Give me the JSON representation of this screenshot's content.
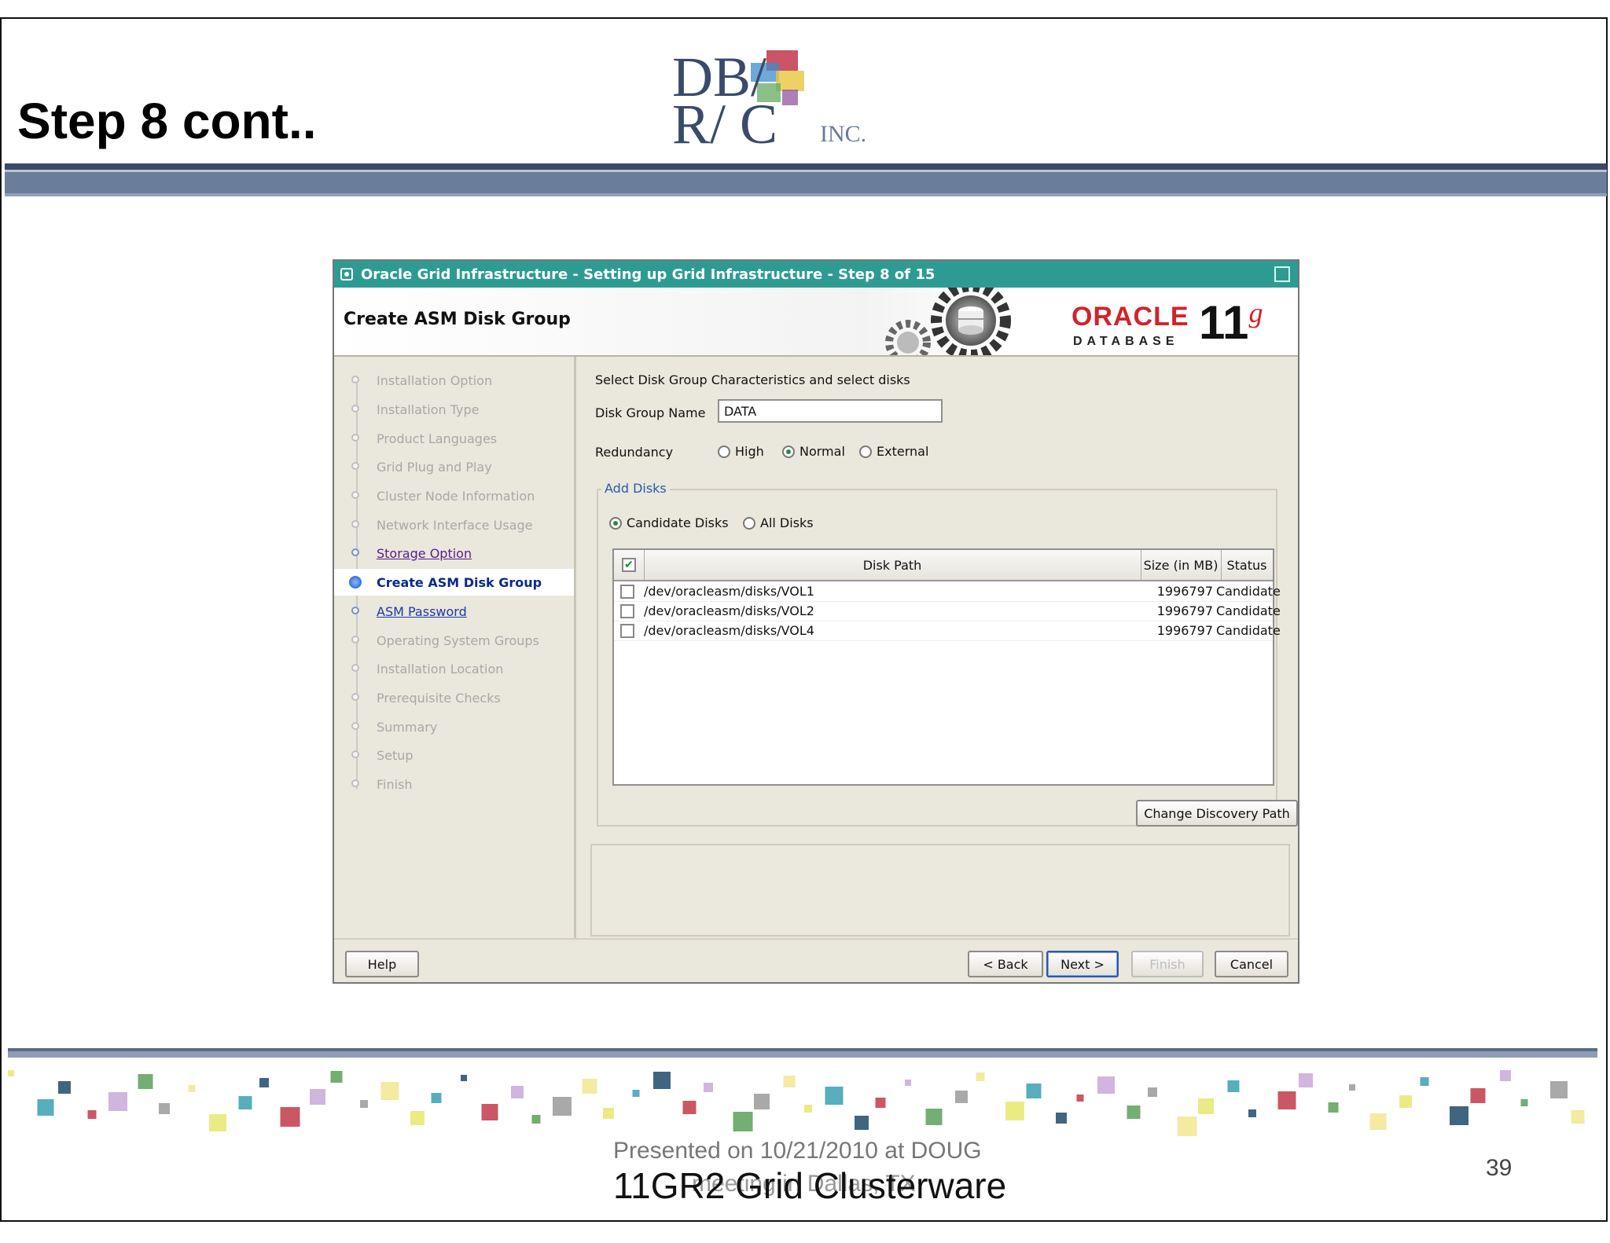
{
  "slide": {
    "title": "Step 8 cont..",
    "footer_presented": "Presented on 10/21/2010 at DOUG",
    "footer_meeting": "meeting in Dallas, TX",
    "footer_title": "11GR2 Grid Clusterware",
    "page_number": "39"
  },
  "logo": {
    "line1": "DB/",
    "line2": "R/ C",
    "inc": "INC."
  },
  "window": {
    "title": "Oracle Grid Infrastructure - Setting up Grid Infrastructure - Step 8 of 15",
    "page_heading": "Create ASM Disk Group",
    "brand": {
      "oracle": "ORACLE",
      "database": "DATABASE",
      "version": "11",
      "version_suffix": "g",
      "accent": "#d2232a"
    }
  },
  "nav": {
    "items": [
      {
        "label": "Installation Option",
        "state": "done"
      },
      {
        "label": "Installation Type",
        "state": "done"
      },
      {
        "label": "Product Languages",
        "state": "done"
      },
      {
        "label": "Grid Plug and Play",
        "state": "done"
      },
      {
        "label": "Cluster Node Information",
        "state": "done"
      },
      {
        "label": "Network Interface Usage",
        "state": "done"
      },
      {
        "label": "Storage Option",
        "state": "visited"
      },
      {
        "label": "Create ASM Disk Group",
        "state": "current"
      },
      {
        "label": "ASM Password",
        "state": "link"
      },
      {
        "label": "Operating System Groups",
        "state": "pending"
      },
      {
        "label": "Installation Location",
        "state": "pending"
      },
      {
        "label": "Prerequisite Checks",
        "state": "pending"
      },
      {
        "label": "Summary",
        "state": "pending"
      },
      {
        "label": "Setup",
        "state": "pending"
      },
      {
        "label": "Finish",
        "state": "pending"
      }
    ]
  },
  "form": {
    "instruction": "Select Disk Group Characteristics and select disks",
    "disk_group_label": "Disk Group Name",
    "disk_group_value": "DATA",
    "redundancy_label": "Redundancy",
    "redundancy_options": [
      "High",
      "Normal",
      "External"
    ],
    "redundancy_selected": "Normal",
    "add_disks_legend": "Add Disks",
    "disk_filter_options": [
      "Candidate Disks",
      "All Disks"
    ],
    "disk_filter_selected": "Candidate Disks",
    "table_headers": [
      "Disk Path",
      "Size (in MB)",
      "Status"
    ],
    "rows": [
      {
        "path": "/dev/oracleasm/disks/VOL1",
        "size": "1996797",
        "status": "Candidate"
      },
      {
        "path": "/dev/oracleasm/disks/VOL2",
        "size": "1996797",
        "status": "Candidate"
      },
      {
        "path": "/dev/oracleasm/disks/VOL4",
        "size": "1996797",
        "status": "Candidate"
      }
    ],
    "change_discovery_label": "Change Discovery Path"
  },
  "buttons": {
    "help": "Help",
    "back": "< Back",
    "next": "Next >",
    "finish": "Finish",
    "cancel": "Cancel"
  }
}
